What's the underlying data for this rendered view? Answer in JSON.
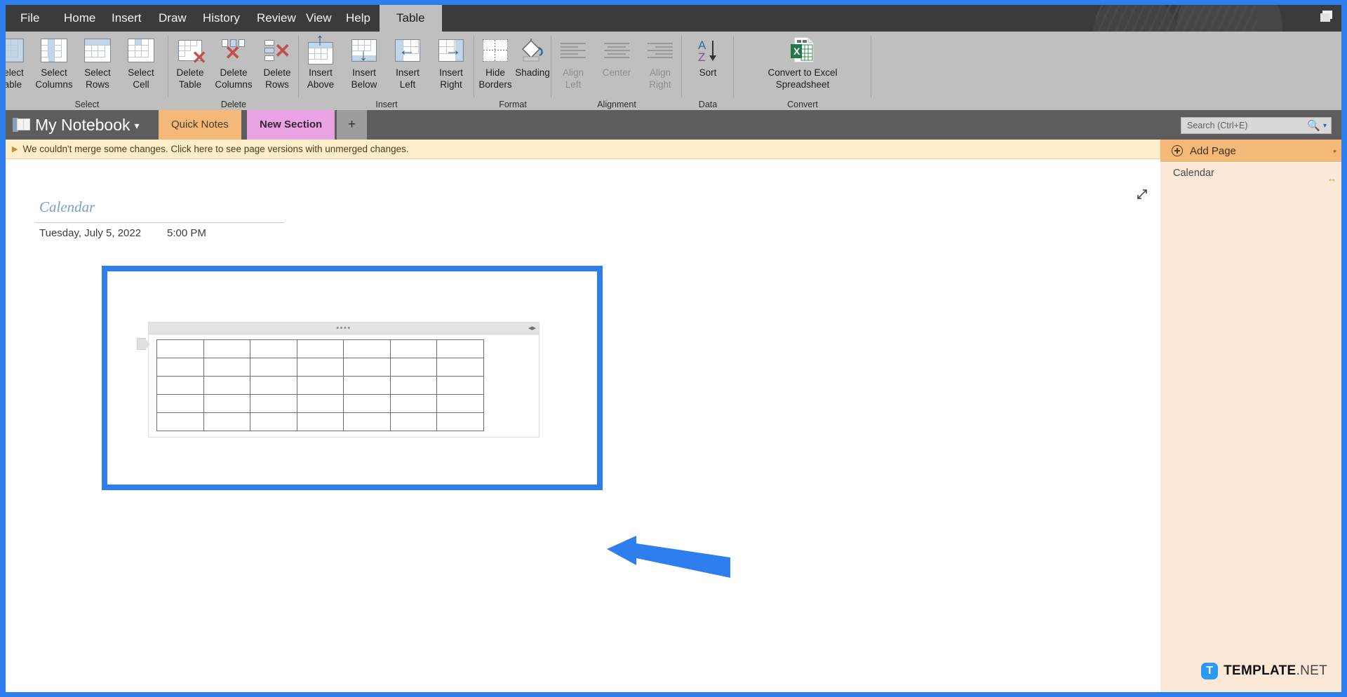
{
  "window": {
    "restore_icon": "restore-window-icon",
    "accent": "#2e7ef0"
  },
  "ribbon": {
    "tabs": [
      {
        "label": "File",
        "active": false
      },
      {
        "label": "Home",
        "active": false
      },
      {
        "label": "Insert",
        "active": false
      },
      {
        "label": "Draw",
        "active": false
      },
      {
        "label": "History",
        "active": false
      },
      {
        "label": "Review",
        "active": false
      },
      {
        "label": "View",
        "active": false
      },
      {
        "label": "Help",
        "active": false
      },
      {
        "label": "Table",
        "active": true
      }
    ],
    "groups": [
      {
        "name": "Select",
        "label": "Select",
        "buttons": [
          {
            "line1": "Select",
            "line2": "Table",
            "icon": "select-table-icon",
            "disabled": false
          },
          {
            "line1": "Select",
            "line2": "Columns",
            "icon": "select-columns-icon",
            "disabled": false
          },
          {
            "line1": "Select",
            "line2": "Rows",
            "icon": "select-rows-icon",
            "disabled": false
          },
          {
            "line1": "Select",
            "line2": "Cell",
            "icon": "select-cell-icon",
            "disabled": false
          }
        ]
      },
      {
        "name": "Delete",
        "label": "Delete",
        "buttons": [
          {
            "line1": "Delete",
            "line2": "Table",
            "icon": "delete-table-icon",
            "disabled": false
          },
          {
            "line1": "Delete",
            "line2": "Columns",
            "icon": "delete-columns-icon",
            "disabled": false
          },
          {
            "line1": "Delete",
            "line2": "Rows",
            "icon": "delete-rows-icon",
            "disabled": false
          }
        ]
      },
      {
        "name": "Insert",
        "label": "Insert",
        "buttons": [
          {
            "line1": "Insert",
            "line2": "Above",
            "icon": "insert-above-icon",
            "disabled": false
          },
          {
            "line1": "Insert",
            "line2": "Below",
            "icon": "insert-below-icon",
            "disabled": false
          },
          {
            "line1": "Insert",
            "line2": "Left",
            "icon": "insert-left-icon",
            "disabled": false
          },
          {
            "line1": "Insert",
            "line2": "Right",
            "icon": "insert-right-icon",
            "disabled": false
          }
        ]
      },
      {
        "name": "Format",
        "label": "Format",
        "buttons": [
          {
            "line1": "Hide",
            "line2": "Borders",
            "icon": "hide-borders-icon",
            "disabled": false
          },
          {
            "line1": "Shading",
            "line2": "",
            "caret": "ⱟ",
            "icon": "shading-icon",
            "disabled": false
          }
        ]
      },
      {
        "name": "Alignment",
        "label": "Alignment",
        "buttons": [
          {
            "line1": "Align",
            "line2": "Left",
            "icon": "align-left-icon",
            "disabled": true
          },
          {
            "line1": "Center",
            "line2": "",
            "icon": "align-center-icon",
            "disabled": true
          },
          {
            "line1": "Align",
            "line2": "Right",
            "icon": "align-right-icon",
            "disabled": true
          }
        ]
      },
      {
        "name": "Data",
        "label": "Data",
        "buttons": [
          {
            "line1": "Sort",
            "line2": "",
            "caret": "ⱟ",
            "icon": "sort-az-icon",
            "disabled": false
          }
        ]
      },
      {
        "name": "Convert",
        "label": "Convert",
        "buttons": [
          {
            "line1": "Convert to Excel",
            "line2": "Spreadsheet",
            "icon": "convert-to-excel-icon",
            "disabled": false
          }
        ]
      }
    ],
    "collapse_icon": "collapse-ribbon-icon"
  },
  "notebook": {
    "title": "My Notebook",
    "chevron": "▾",
    "icon": "notebook-icon",
    "sections": [
      {
        "label": "Quick Notes",
        "color": "#f4b878",
        "active": true
      },
      {
        "label": "New Section",
        "color": "#e9a3e3",
        "active": false
      }
    ],
    "add_section_label": "+"
  },
  "search": {
    "placeholder": "Search (Ctrl+E)",
    "value": "",
    "icon": "search-icon",
    "dropdown": "▾"
  },
  "notice": {
    "text": "We couldn't merge some changes. Click here to see page versions with unmerged changes.",
    "icon": "expand-notice-icon",
    "background": "#fdeec9"
  },
  "page": {
    "title": "Calendar",
    "date": "Tuesday, July 5, 2022",
    "time": "5:00 PM",
    "expand_icon": "expand-page-icon",
    "table": {
      "columns": 7,
      "rows": 5,
      "handle_dots": "••••",
      "grip": "◂▸",
      "row_handle_icon": "row-selection-handle-icon"
    },
    "selection_color": "#2e7ef0",
    "annotation_arrow": "annotation-arrow-left"
  },
  "right_pane": {
    "add_page_label": "Add Page",
    "add_page_icon": "add-page-icon",
    "add_page_menu_dot": "•",
    "pages": [
      {
        "label": "Calendar",
        "move_icon": "↔"
      }
    ]
  },
  "watermark": {
    "badge": "T",
    "name": "TEMPLATE",
    "tld": ".NET"
  }
}
